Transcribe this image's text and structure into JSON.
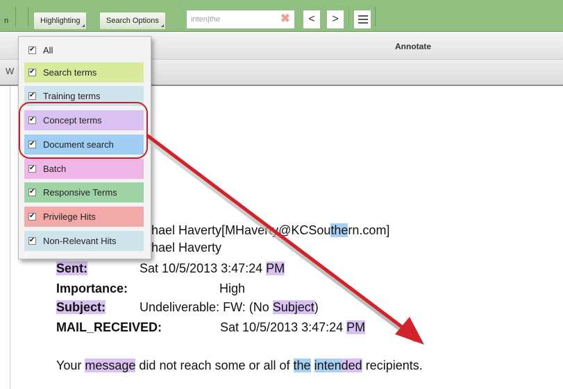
{
  "toolbar": {
    "left_fragment": "n",
    "highlighting_label": "Highlighting",
    "search_options_label": "Search Options",
    "search_value": "inten|the",
    "prev_label": "<",
    "next_label": ">"
  },
  "annotate": {
    "label": "Annotate",
    "subbar_fragment": "W"
  },
  "highlight_menu": {
    "items": [
      {
        "label": "All",
        "checked": true,
        "color": "#f3f3f3"
      },
      {
        "label": "Search terms",
        "checked": true,
        "color": "#d8ea9c"
      },
      {
        "label": "Training terms",
        "checked": true,
        "color": "#cfe3ec"
      },
      {
        "label": "Concept terms",
        "checked": true,
        "color": "#d9c2f2"
      },
      {
        "label": "Document search",
        "checked": true,
        "color": "#9fcdf3"
      },
      {
        "label": "Batch",
        "checked": true,
        "color": "#f0b6e8"
      },
      {
        "label": "Responsive Terms",
        "checked": true,
        "color": "#9fd3a6"
      },
      {
        "label": "Privilege Hits",
        "checked": true,
        "color": "#f2a9a7"
      },
      {
        "label": "Non-Relevant Hits",
        "checked": true,
        "color": "#cfe3ec"
      }
    ]
  },
  "email": {
    "from_fragment": "ichael Haverty[",
    "from_mid": "MHaverty@KCSou",
    "from_hl": "the",
    "from_end": "rn.com]",
    "to_fragment": "ichael Haverty",
    "sent_label": "Sent:",
    "sent_value": "Sat 10/5/2013 3:47:24 ",
    "sent_pm": "PM",
    "importance_label": "Importance:",
    "importance_value": "High",
    "subject_label": "Subject:",
    "subject_value": "Undeliverable: FW: (No ",
    "subject_hl": "Subject",
    "subject_end": ")",
    "received_label": "MAIL_RECEIVED:",
    "received_value": "Sat 10/5/2013 3:47:24 ",
    "received_pm": "PM",
    "body_w1": "Your ",
    "body_message": "message",
    "body_w2": " did not reach some or all of ",
    "body_the": "the",
    "body_space": " ",
    "body_inten": "inten",
    "body_ded": "ded",
    "body_end": " recipients."
  },
  "colors": {
    "toolbar": "#8fc07f",
    "annotation_red": "#c51f24",
    "concept_highlight": "#d9c2f2",
    "document_search_highlight": "#a8d0f5"
  }
}
